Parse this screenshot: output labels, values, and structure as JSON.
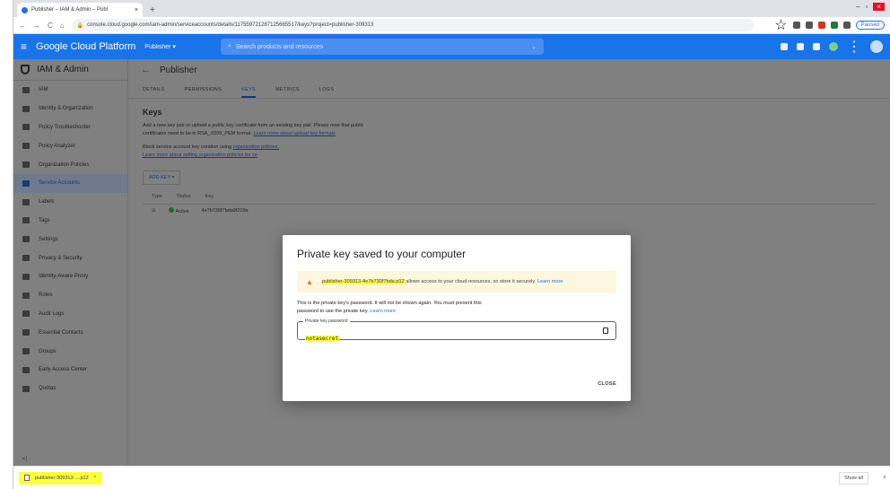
{
  "browser": {
    "tab_title": "Publisher – IAM & Admin – Publ",
    "tab_close": "×",
    "new_tab": "+",
    "url": "console.cloud.google.com/iam-admin/serviceaccounts/details/117559721287125665517/keys?project=publisher-309313",
    "paused_label": "Paused",
    "window_controls": [
      "–",
      "▫",
      "×"
    ]
  },
  "header": {
    "title": "Google Cloud Platform",
    "project": "Publisher",
    "search_placeholder": "Search products and resources"
  },
  "sidebar": {
    "title": "IAM & Admin",
    "items": [
      {
        "label": "IAM",
        "icon": "person-add-icon"
      },
      {
        "label": "Identity & Organization",
        "icon": "identity-icon"
      },
      {
        "label": "Policy Troubleshooter",
        "icon": "wrench-icon"
      },
      {
        "label": "Policy Analyzer",
        "icon": "analyzer-icon"
      },
      {
        "label": "Organization Policies",
        "icon": "policy-icon"
      },
      {
        "label": "Service Accounts",
        "icon": "service-account-icon",
        "active": true
      },
      {
        "label": "Labels",
        "icon": "label-icon"
      },
      {
        "label": "Tags",
        "icon": "tag-icon"
      },
      {
        "label": "Settings",
        "icon": "gear-icon"
      },
      {
        "label": "Privacy & Security",
        "icon": "shield-icon"
      },
      {
        "label": "Identity-Aware Proxy",
        "icon": "proxy-icon"
      },
      {
        "label": "Roles",
        "icon": "roles-icon"
      },
      {
        "label": "Audit Logs",
        "icon": "log-icon"
      },
      {
        "label": "Essential Contacts",
        "icon": "contacts-icon"
      },
      {
        "label": "Groups",
        "icon": "groups-icon"
      },
      {
        "label": "Early Access Center",
        "icon": "early-access-icon"
      },
      {
        "label": "Quotas",
        "icon": "quota-icon"
      }
    ],
    "footer": "<|"
  },
  "main": {
    "title": "Publisher",
    "tabs": [
      "DETAILS",
      "PERMISSIONS",
      "KEYS",
      "METRICS",
      "LOGS"
    ],
    "active_tab": "KEYS",
    "keys_heading": "Keys",
    "keys_desc": "Add a new key pair or upload a public key certificate from an existing key pair. Please note that public certificates need to be in RSA_X509_PEM format.",
    "keys_desc_link": "Learn more about upload key formats",
    "block_text": "Block service account key creation using",
    "block_link": "organization policies.",
    "block_link2": "Learn more about setting organization policies for se",
    "add_key": "ADD KEY ▾",
    "table_headers": [
      "Type",
      "Status",
      "Key"
    ],
    "table_row": {
      "status": "Active",
      "key": "4e7b730f7bda9f219a"
    }
  },
  "dialog": {
    "title": "Private key saved to your computer",
    "warn_file": "publisher-309313-4e7b730f7bda.p12",
    "warn_text": "allows access to your cloud resources, so store it securely.",
    "warn_link": "Learn more",
    "body_text": "This is the private key's password. It will not be shown again. You must present this password to use the private key.",
    "body_link": "Learn more",
    "pw_label": "Private key password",
    "pw_value": "notasecret",
    "close": "CLOSE"
  },
  "downloads": {
    "item": "publisher-309313-....p12",
    "item_chevron": "^",
    "show_all": "Show all",
    "close": "×"
  }
}
